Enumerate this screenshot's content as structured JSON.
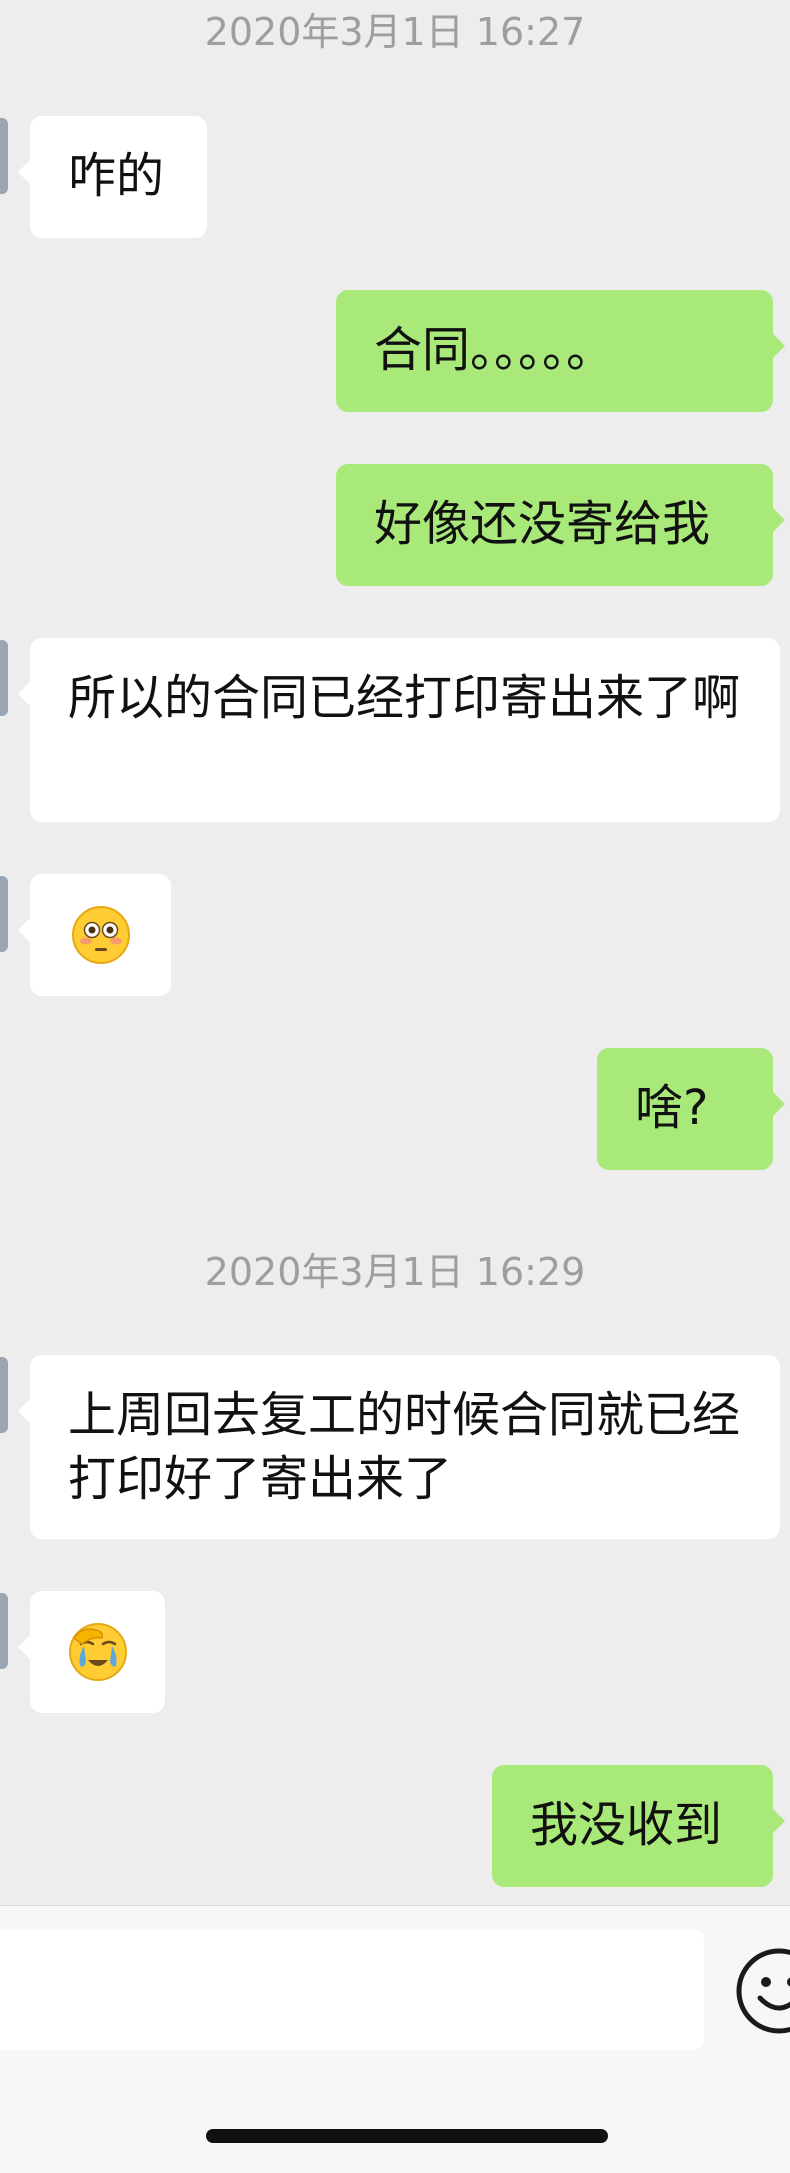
{
  "timestamps": {
    "first": "2020年3月1日 16:27",
    "second": "2020年3月1日 16:29"
  },
  "messages": [
    {
      "side": "received",
      "text": "咋的"
    },
    {
      "side": "sent",
      "text": "合同。。。。。"
    },
    {
      "side": "sent",
      "text": "好像还没寄给我"
    },
    {
      "side": "received",
      "text": "所以的合同已经打印寄出来了啊"
    },
    {
      "side": "received",
      "emoji": "flushed-face"
    },
    {
      "side": "sent",
      "text": "啥?"
    },
    {
      "side": "received",
      "text": "上周回去复工的时候合同就已经打印好了寄出来了"
    },
    {
      "side": "received",
      "emoji": "crying-face-with-hand"
    },
    {
      "side": "sent",
      "text": "我没收到"
    }
  ],
  "input_bar": {
    "value": "",
    "emoji_button_icon": "smiley-face-icon"
  },
  "colors": {
    "background": "#ededed",
    "sent_bubble": "#a9e97a",
    "received_bubble": "#ffffff",
    "timestamp_text": "#9e9e9e"
  }
}
